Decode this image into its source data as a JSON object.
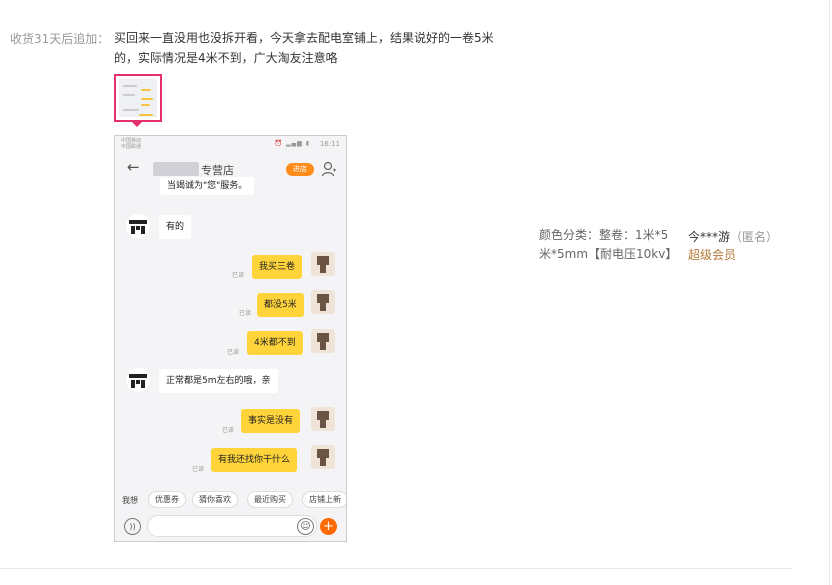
{
  "review": {
    "append_label": "收货31天后追加：",
    "text": "买回来一直没用也没拆开看，今天拿去配电室铺上，结果说好的一卷5米的，实际情况是4米不到，广大淘友注意咯"
  },
  "chat_screenshot": {
    "shop_name": "专营店",
    "enter_shop_label": "进店",
    "truncated_message": "当竭诚为\"您\"服务。",
    "read_label": "已读",
    "messages": [
      {
        "side": "left",
        "text": "有的"
      },
      {
        "side": "right",
        "text": "我买三卷"
      },
      {
        "side": "right",
        "text": "都没5米"
      },
      {
        "side": "right",
        "text": "4米都不到"
      },
      {
        "side": "left",
        "text": "正常都是5m左右的哦，亲"
      },
      {
        "side": "right",
        "text": "事实是没有"
      },
      {
        "side": "right",
        "text": "有我还找你干什么"
      }
    ],
    "quick_replies": [
      "我想",
      "优惠券",
      "猜你喜欢",
      "最近购买",
      "店铺上新"
    ],
    "status_time": "16:11",
    "icons": [
      "back-arrow-icon",
      "person-icon",
      "voice-icon",
      "emoji-icon",
      "plus-icon"
    ]
  },
  "sku": {
    "label": "颜色分类：",
    "value": "整卷：1米*5米*5mm【耐电压10kv】"
  },
  "user": {
    "name": "今***游",
    "anonymous": "（匿名）",
    "level": "超级会员"
  },
  "colors": {
    "highlight": "#e4306b",
    "member": "#b47a3c",
    "bubble_mine": "#ffd43b",
    "accent_orange": "#ff6a00"
  }
}
